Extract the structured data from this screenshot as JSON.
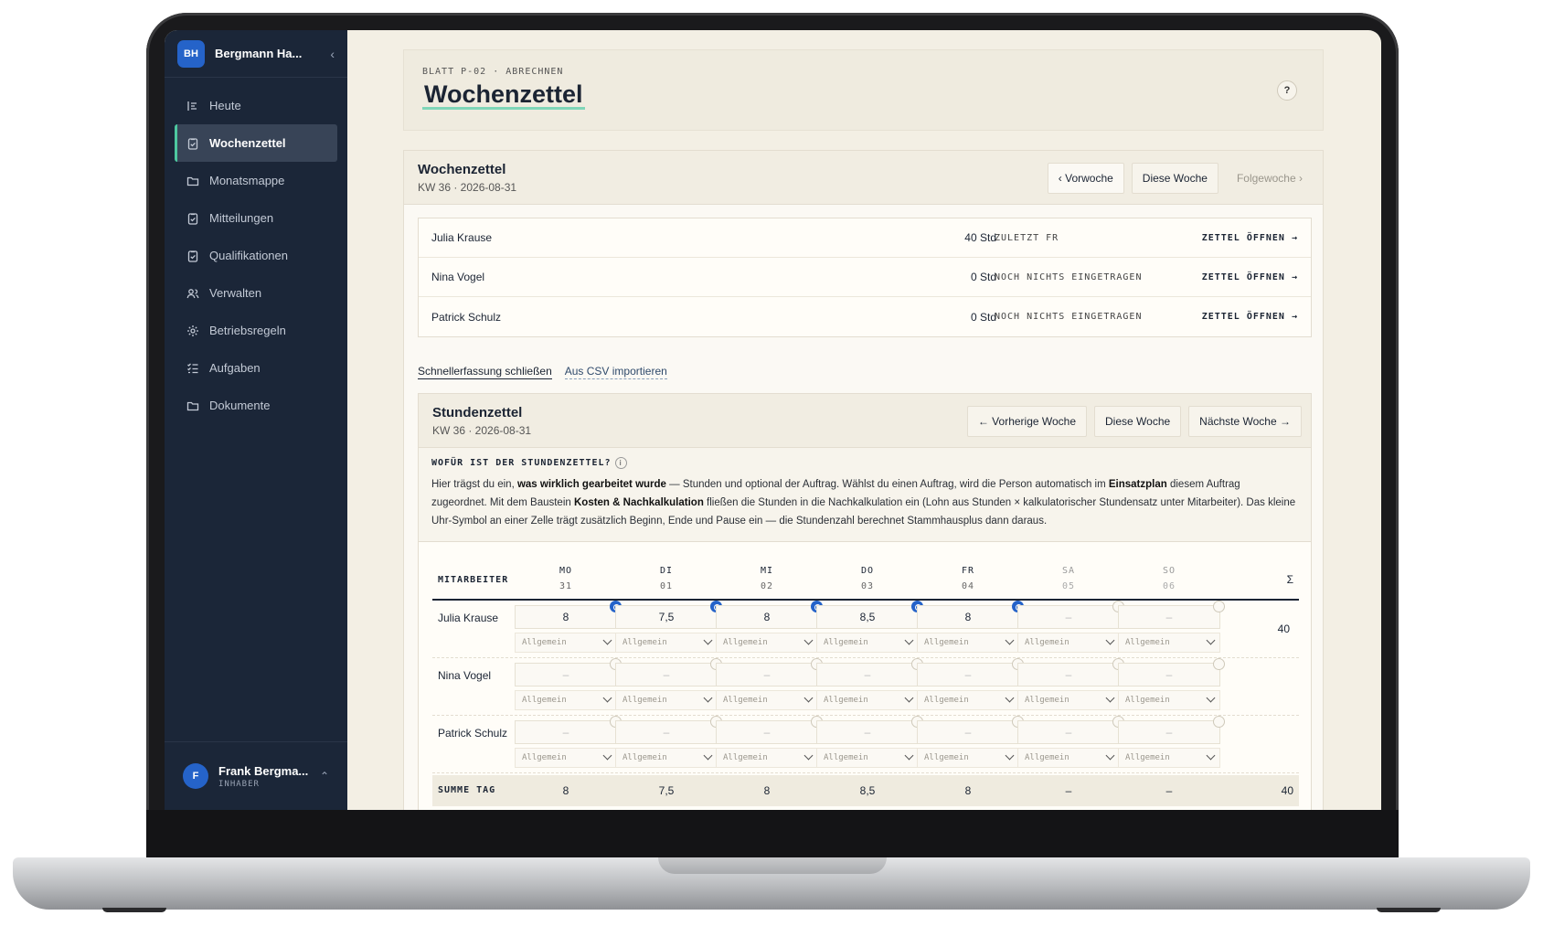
{
  "workspace": {
    "initials": "BH",
    "name": "Bergmann Ha..."
  },
  "nav": [
    {
      "label": "Heute",
      "icon": "today-icon"
    },
    {
      "label": "Wochenzettel",
      "icon": "clipboard-icon",
      "active": true
    },
    {
      "label": "Monatsmappe",
      "icon": "folder-icon"
    },
    {
      "label": "Mitteilungen",
      "icon": "clipboard-icon"
    },
    {
      "label": "Qualifikationen",
      "icon": "clipboard-icon"
    },
    {
      "label": "Verwalten",
      "icon": "users-icon"
    },
    {
      "label": "Betriebsregeln",
      "icon": "gear-icon"
    },
    {
      "label": "Aufgaben",
      "icon": "checklist-icon"
    },
    {
      "label": "Dokumente",
      "icon": "folder-icon"
    }
  ],
  "user": {
    "initial": "F",
    "name": "Frank Bergma...",
    "role": "INHABER"
  },
  "page": {
    "breadcrumb": "BLATT P-02 · ABRECHNEN",
    "title": "Wochenzettel",
    "help": "?"
  },
  "week_card": {
    "title": "Wochenzettel",
    "subtitle": "KW 36 · 2026-08-31",
    "prev": "‹ Vorwoche",
    "current": "Diese Woche",
    "next": "Folgewoche ›",
    "employees": [
      {
        "name": "Julia Krause",
        "hours": "40 Std",
        "status": "ZULETZT FR",
        "action": "ZETTEL ÖFFNEN →"
      },
      {
        "name": "Nina Vogel",
        "hours": "0 Std",
        "status": "NOCH NICHTS EINGETRAGEN",
        "action": "ZETTEL ÖFFNEN →"
      },
      {
        "name": "Patrick Schulz",
        "hours": "0 Std",
        "status": "NOCH NICHTS EINGETRAGEN",
        "action": "ZETTEL ÖFFNEN →"
      }
    ]
  },
  "quick_links": {
    "close": "Schnellerfassung schließen",
    "csv": "Aus CSV importieren"
  },
  "sheet": {
    "title": "Stundenzettel",
    "subtitle": "KW 36 · 2026-08-31",
    "prev": "← Vorherige Woche",
    "current": "Diese Woche",
    "next": "Nächste Woche →",
    "info_title": "WOFÜR IST DER STUNDENZETTEL?",
    "info_icon": "i",
    "info_1": "Hier trägst du ein, ",
    "info_b1": "was wirklich gearbeitet wurde",
    "info_2": " — Stunden und optional der Auftrag. Wählst du einen Auftrag, wird die Person automatisch im ",
    "info_b2": "Einsatzplan",
    "info_3": " diesem Auftrag zugeordnet. Mit dem Baustein ",
    "info_b3": "Kosten & Nachkalkulation",
    "info_4": " fließen die Stunden in die Nachkalkulation ein (Lohn aus Stunden × kalkulatorischer Stundensatz unter Mitarbeiter). Das kleine Uhr-Symbol an einer Zelle trägt zusätzlich Beginn, Ende und Pause ein — die Stundenzahl berechnet Stammhausplus dann daraus.",
    "col_employee": "MITARBEITER",
    "col_sum": "Σ",
    "days": [
      {
        "d": "MO",
        "n": "31"
      },
      {
        "d": "DI",
        "n": "01"
      },
      {
        "d": "MI",
        "n": "02"
      },
      {
        "d": "DO",
        "n": "03"
      },
      {
        "d": "FR",
        "n": "04"
      },
      {
        "d": "SA",
        "n": "05",
        "weekend": true
      },
      {
        "d": "SO",
        "n": "06",
        "weekend": true
      }
    ],
    "rows": [
      {
        "name": "Julia Krause",
        "values": [
          "8",
          "7,5",
          "8",
          "8,5",
          "8",
          "–",
          "–"
        ],
        "clock": [
          true,
          true,
          true,
          true,
          true,
          false,
          false
        ],
        "sum": "40"
      },
      {
        "name": "Nina Vogel",
        "values": [
          "–",
          "–",
          "–",
          "–",
          "–",
          "–",
          "–"
        ],
        "clock": [
          false,
          false,
          false,
          false,
          false,
          false,
          false
        ],
        "sum": ""
      },
      {
        "name": "Patrick Schulz",
        "values": [
          "–",
          "–",
          "–",
          "–",
          "–",
          "–",
          "–"
        ],
        "clock": [
          false,
          false,
          false,
          false,
          false,
          false,
          false
        ],
        "sum": ""
      }
    ],
    "select_default": "Allgemein",
    "sum_label": "SUMME TAG",
    "day_sums": [
      "8",
      "7,5",
      "8",
      "8,5",
      "8",
      "–",
      "–"
    ],
    "total": "40"
  }
}
